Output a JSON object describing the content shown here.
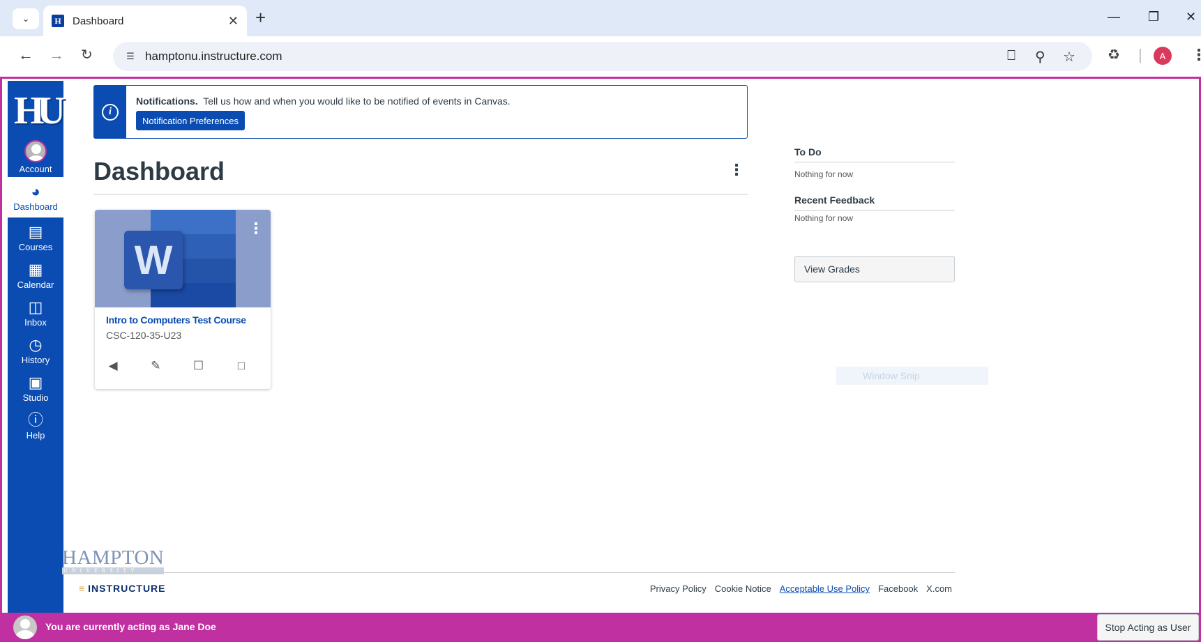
{
  "browser": {
    "tab_title": "Dashboard",
    "url": "hamptonu.instructure.com",
    "profile_initial": "A"
  },
  "notification": {
    "heading": "Notifications.",
    "message": "Tell us how and when you would like to be notified of events in Canvas.",
    "button_label": "Notification Preferences"
  },
  "global_nav": {
    "items": [
      {
        "label": "Account"
      },
      {
        "label": "Dashboard"
      },
      {
        "label": "Courses"
      },
      {
        "label": "Calendar"
      },
      {
        "label": "Inbox"
      },
      {
        "label": "History"
      },
      {
        "label": "Studio"
      },
      {
        "label": "Help"
      }
    ]
  },
  "dashboard": {
    "title": "Dashboard"
  },
  "course_card": {
    "title": "Intro to Computers Test Course",
    "code": "CSC-120-35-U23",
    "hero_letter": "W"
  },
  "right_sidebar": {
    "todo_heading": "To Do",
    "todo_empty": "Nothing for now",
    "feedback_heading": "Recent Feedback",
    "feedback_empty": "Nothing for now",
    "view_grades_label": "View Grades",
    "snip_ghost": "Window Snip"
  },
  "footer": {
    "university_name": "HAMPTON",
    "university_sub": "UNIVERSITY",
    "instructure": "INSTRUCTURE",
    "links": [
      "Privacy Policy",
      "Cookie Notice",
      "Acceptable Use Policy",
      "Facebook",
      "X.com"
    ]
  },
  "acting_bar": {
    "message": "You are currently acting as Jane Doe",
    "stop_label": "Stop Acting as User"
  },
  "colors": {
    "nav_blue": "#0a4cb1",
    "acting_magenta": "#c130a0"
  }
}
